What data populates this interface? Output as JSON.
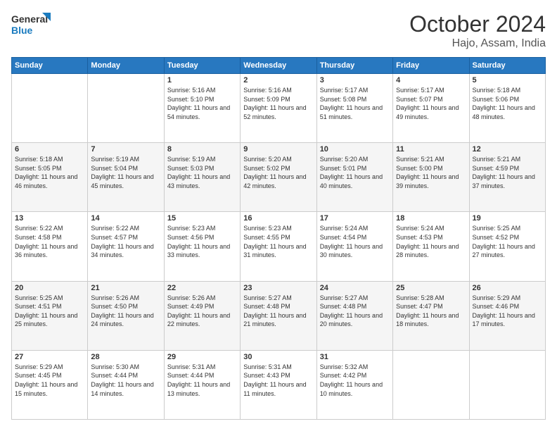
{
  "header": {
    "logo_general": "General",
    "logo_blue": "Blue",
    "month_title": "October 2024",
    "location": "Hajo, Assam, India"
  },
  "days_of_week": [
    "Sunday",
    "Monday",
    "Tuesday",
    "Wednesday",
    "Thursday",
    "Friday",
    "Saturday"
  ],
  "weeks": [
    [
      {
        "day": "",
        "info": ""
      },
      {
        "day": "",
        "info": ""
      },
      {
        "day": "1",
        "info": "Sunrise: 5:16 AM\nSunset: 5:10 PM\nDaylight: 11 hours and 54 minutes."
      },
      {
        "day": "2",
        "info": "Sunrise: 5:16 AM\nSunset: 5:09 PM\nDaylight: 11 hours and 52 minutes."
      },
      {
        "day": "3",
        "info": "Sunrise: 5:17 AM\nSunset: 5:08 PM\nDaylight: 11 hours and 51 minutes."
      },
      {
        "day": "4",
        "info": "Sunrise: 5:17 AM\nSunset: 5:07 PM\nDaylight: 11 hours and 49 minutes."
      },
      {
        "day": "5",
        "info": "Sunrise: 5:18 AM\nSunset: 5:06 PM\nDaylight: 11 hours and 48 minutes."
      }
    ],
    [
      {
        "day": "6",
        "info": "Sunrise: 5:18 AM\nSunset: 5:05 PM\nDaylight: 11 hours and 46 minutes."
      },
      {
        "day": "7",
        "info": "Sunrise: 5:19 AM\nSunset: 5:04 PM\nDaylight: 11 hours and 45 minutes."
      },
      {
        "day": "8",
        "info": "Sunrise: 5:19 AM\nSunset: 5:03 PM\nDaylight: 11 hours and 43 minutes."
      },
      {
        "day": "9",
        "info": "Sunrise: 5:20 AM\nSunset: 5:02 PM\nDaylight: 11 hours and 42 minutes."
      },
      {
        "day": "10",
        "info": "Sunrise: 5:20 AM\nSunset: 5:01 PM\nDaylight: 11 hours and 40 minutes."
      },
      {
        "day": "11",
        "info": "Sunrise: 5:21 AM\nSunset: 5:00 PM\nDaylight: 11 hours and 39 minutes."
      },
      {
        "day": "12",
        "info": "Sunrise: 5:21 AM\nSunset: 4:59 PM\nDaylight: 11 hours and 37 minutes."
      }
    ],
    [
      {
        "day": "13",
        "info": "Sunrise: 5:22 AM\nSunset: 4:58 PM\nDaylight: 11 hours and 36 minutes."
      },
      {
        "day": "14",
        "info": "Sunrise: 5:22 AM\nSunset: 4:57 PM\nDaylight: 11 hours and 34 minutes."
      },
      {
        "day": "15",
        "info": "Sunrise: 5:23 AM\nSunset: 4:56 PM\nDaylight: 11 hours and 33 minutes."
      },
      {
        "day": "16",
        "info": "Sunrise: 5:23 AM\nSunset: 4:55 PM\nDaylight: 11 hours and 31 minutes."
      },
      {
        "day": "17",
        "info": "Sunrise: 5:24 AM\nSunset: 4:54 PM\nDaylight: 11 hours and 30 minutes."
      },
      {
        "day": "18",
        "info": "Sunrise: 5:24 AM\nSunset: 4:53 PM\nDaylight: 11 hours and 28 minutes."
      },
      {
        "day": "19",
        "info": "Sunrise: 5:25 AM\nSunset: 4:52 PM\nDaylight: 11 hours and 27 minutes."
      }
    ],
    [
      {
        "day": "20",
        "info": "Sunrise: 5:25 AM\nSunset: 4:51 PM\nDaylight: 11 hours and 25 minutes."
      },
      {
        "day": "21",
        "info": "Sunrise: 5:26 AM\nSunset: 4:50 PM\nDaylight: 11 hours and 24 minutes."
      },
      {
        "day": "22",
        "info": "Sunrise: 5:26 AM\nSunset: 4:49 PM\nDaylight: 11 hours and 22 minutes."
      },
      {
        "day": "23",
        "info": "Sunrise: 5:27 AM\nSunset: 4:48 PM\nDaylight: 11 hours and 21 minutes."
      },
      {
        "day": "24",
        "info": "Sunrise: 5:27 AM\nSunset: 4:48 PM\nDaylight: 11 hours and 20 minutes."
      },
      {
        "day": "25",
        "info": "Sunrise: 5:28 AM\nSunset: 4:47 PM\nDaylight: 11 hours and 18 minutes."
      },
      {
        "day": "26",
        "info": "Sunrise: 5:29 AM\nSunset: 4:46 PM\nDaylight: 11 hours and 17 minutes."
      }
    ],
    [
      {
        "day": "27",
        "info": "Sunrise: 5:29 AM\nSunset: 4:45 PM\nDaylight: 11 hours and 15 minutes."
      },
      {
        "day": "28",
        "info": "Sunrise: 5:30 AM\nSunset: 4:44 PM\nDaylight: 11 hours and 14 minutes."
      },
      {
        "day": "29",
        "info": "Sunrise: 5:31 AM\nSunset: 4:44 PM\nDaylight: 11 hours and 13 minutes."
      },
      {
        "day": "30",
        "info": "Sunrise: 5:31 AM\nSunset: 4:43 PM\nDaylight: 11 hours and 11 minutes."
      },
      {
        "day": "31",
        "info": "Sunrise: 5:32 AM\nSunset: 4:42 PM\nDaylight: 11 hours and 10 minutes."
      },
      {
        "day": "",
        "info": ""
      },
      {
        "day": "",
        "info": ""
      }
    ]
  ]
}
